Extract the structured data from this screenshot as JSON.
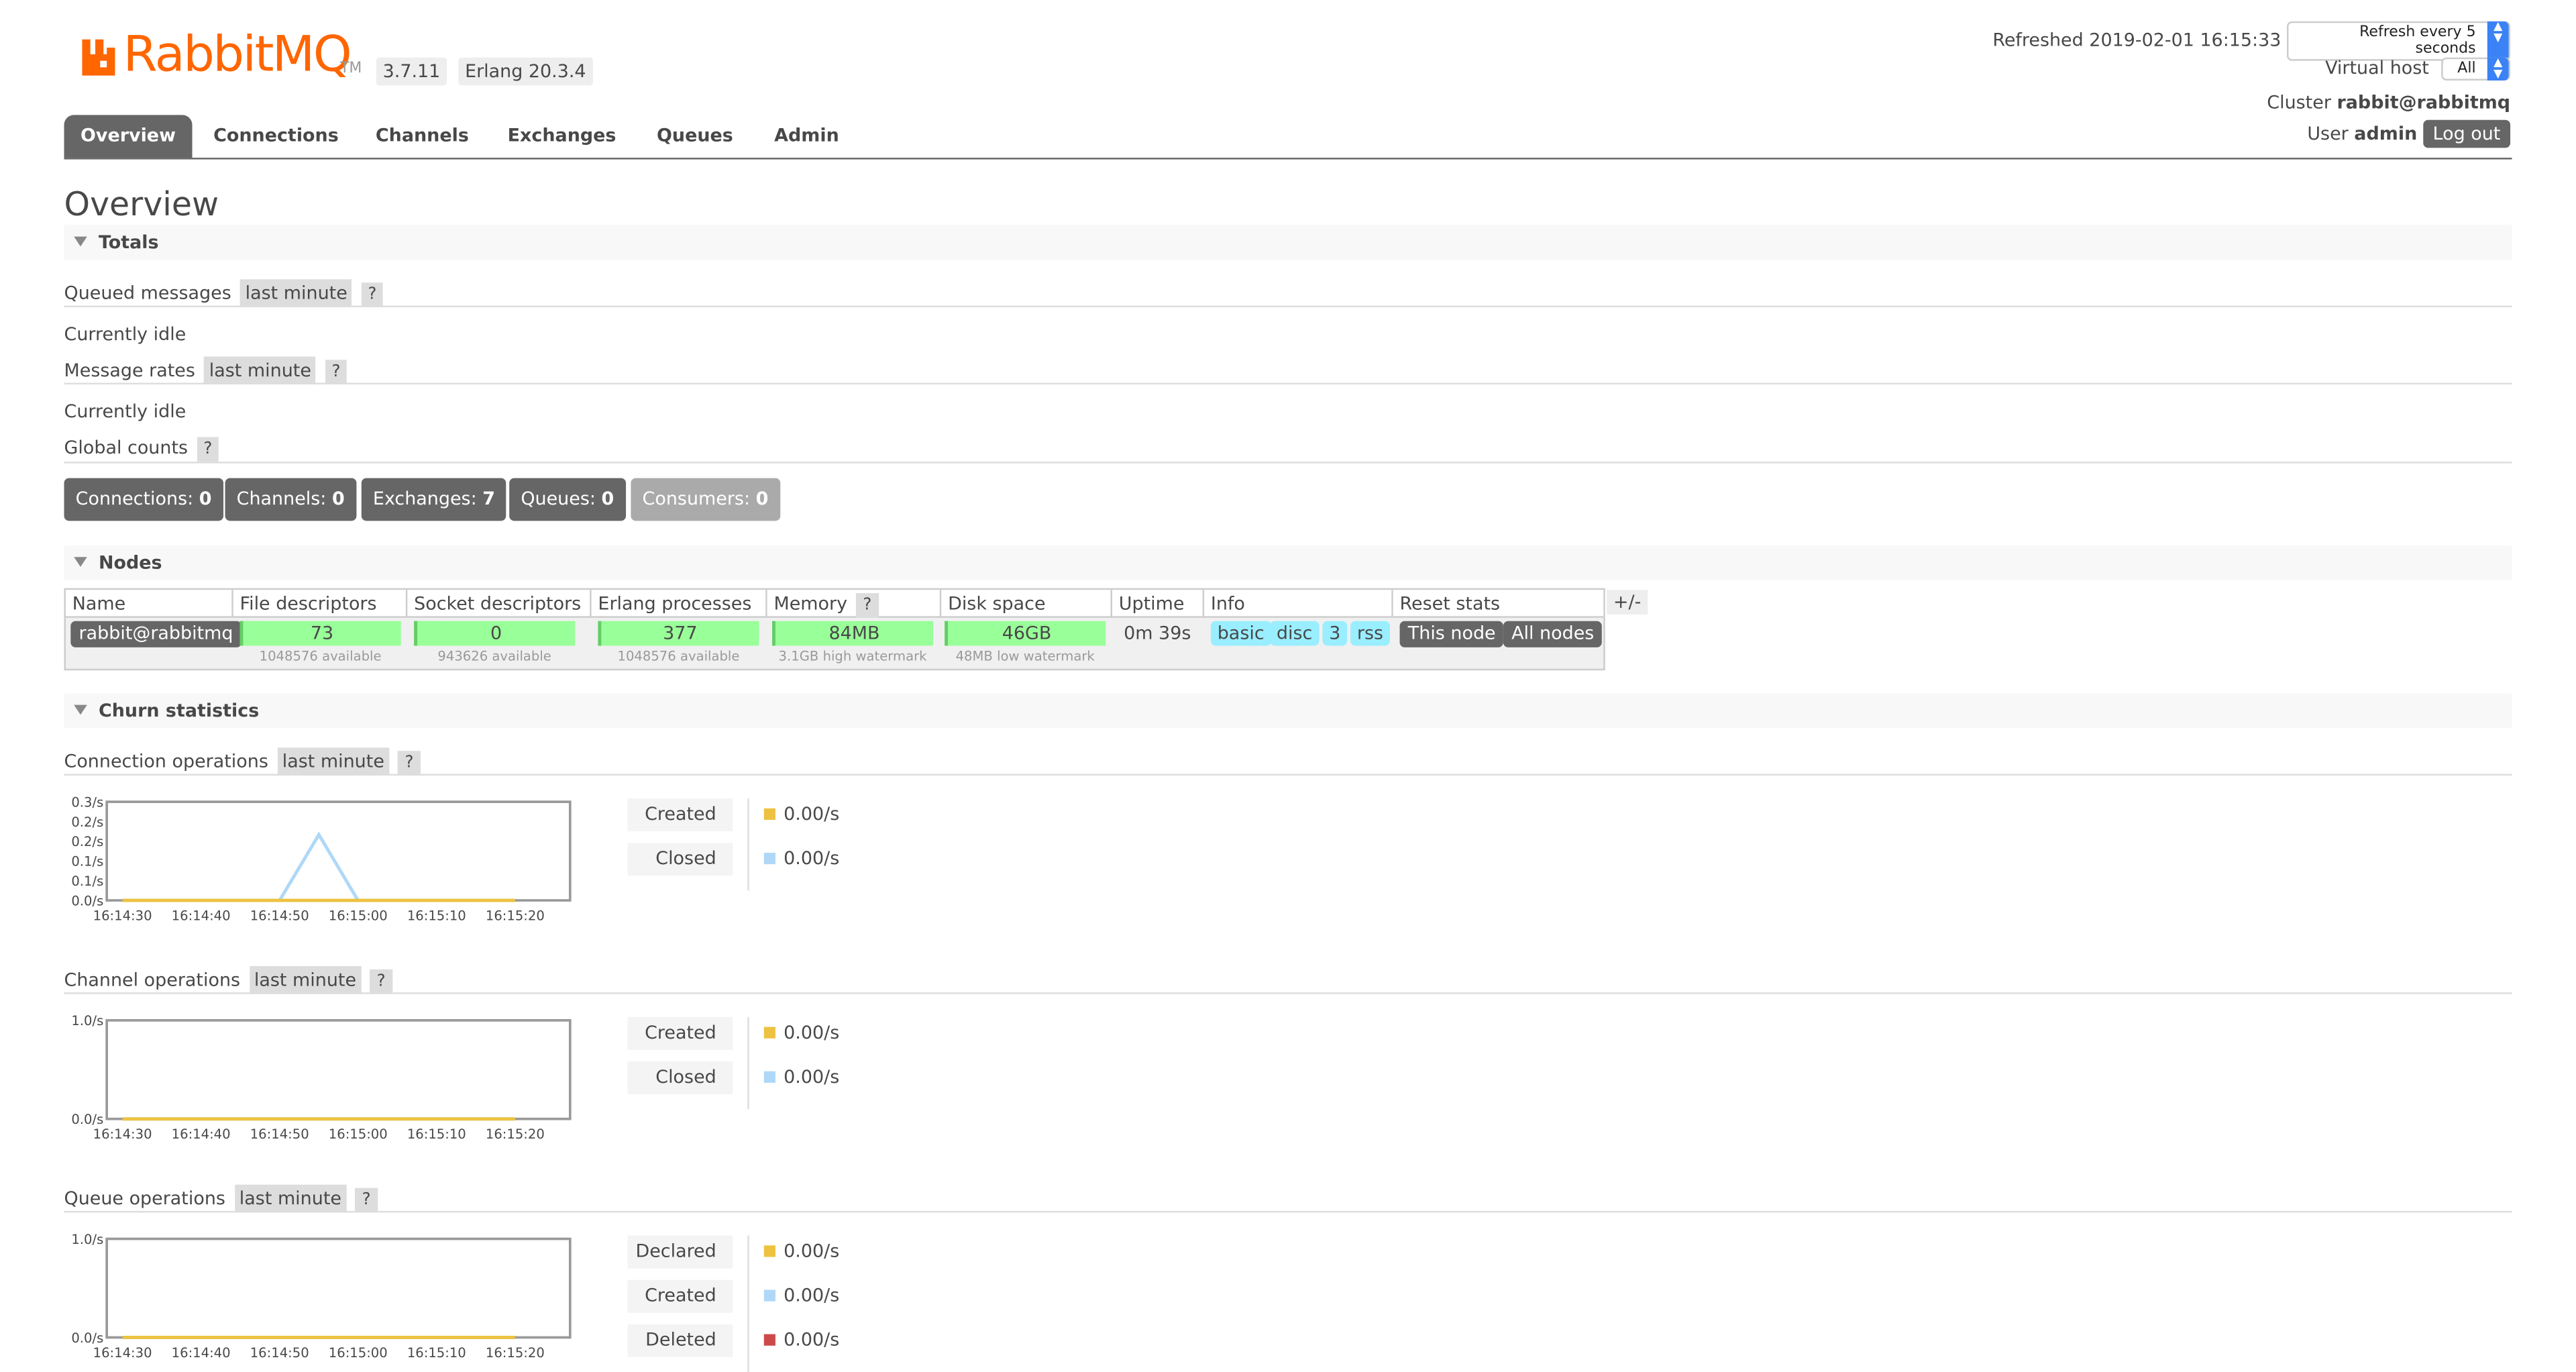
{
  "header": {
    "logo_text": "RabbitMQ",
    "logo_tm": "TM",
    "version": "3.7.11",
    "erlang": "Erlang 20.3.4",
    "refreshed": "Refreshed 2019-02-01 16:15:33",
    "refresh_select": "Refresh every 5 seconds",
    "vhost_label": "Virtual host",
    "vhost_value": "All",
    "cluster_label": "Cluster",
    "cluster_value": "rabbit@rabbitmq",
    "user_label": "User",
    "user_value": "admin",
    "logout": "Log out",
    "brand_color": "#FF6600"
  },
  "tabs": [
    "Overview",
    "Connections",
    "Channels",
    "Exchanges",
    "Queues",
    "Admin"
  ],
  "page_title": "Overview",
  "totals": {
    "section": "Totals",
    "queued_label": "Queued messages",
    "queued_period": "last minute",
    "help": "?",
    "idle1": "Currently idle",
    "rates_label": "Message rates",
    "rates_period": "last minute",
    "idle2": "Currently idle",
    "global_label": "Global counts",
    "counts": [
      {
        "label": "Connections:",
        "value": "0"
      },
      {
        "label": "Channels:",
        "value": "0"
      },
      {
        "label": "Exchanges:",
        "value": "7"
      },
      {
        "label": "Queues:",
        "value": "0"
      },
      {
        "label": "Consumers:",
        "value": "0"
      }
    ]
  },
  "nodes": {
    "section": "Nodes",
    "plusminus": "+/-",
    "headers": [
      "Name",
      "File descriptors",
      "Socket descriptors",
      "Erlang processes",
      "Memory",
      "Disk space",
      "Uptime",
      "Info",
      "Reset stats"
    ],
    "name": "rabbit@rabbitmq",
    "file_desc": "73",
    "file_desc_sub": "1048576 available",
    "socket_desc": "0",
    "socket_desc_sub": "943626 available",
    "erlang_proc": "377",
    "erlang_proc_sub": "1048576 available",
    "memory": "84MB",
    "memory_sub": "3.1GB high watermark",
    "disk": "46GB",
    "disk_sub": "48MB low watermark",
    "uptime": "0m 39s",
    "info": [
      "basic",
      "disc",
      "3",
      "rss"
    ],
    "reset": [
      "This node",
      "All nodes"
    ]
  },
  "churn": {
    "section": "Churn statistics",
    "period": "last minute",
    "help": "?",
    "charts": [
      {
        "title": "Connection operations",
        "type": "line",
        "y_ticks": [
          "0.3/s",
          "0.2/s",
          "0.2/s",
          "0.1/s",
          "0.1/s",
          "0.0/s"
        ],
        "ylim": [
          0,
          0.3
        ],
        "x_ticks": [
          "16:14:30",
          "16:14:40",
          "16:14:50",
          "16:15:00",
          "16:15:10",
          "16:15:20"
        ],
        "series": [
          {
            "name": "Created",
            "rate": "0.00/s",
            "color": "#EDC240",
            "points": [
              [
                "16:14:30",
                0
              ],
              [
                "16:14:50",
                0
              ],
              [
                "16:15:00",
                0
              ],
              [
                "16:15:20",
                0
              ]
            ]
          },
          {
            "name": "Closed",
            "rate": "0.00/s",
            "color": "#AFD8F8",
            "points": [
              [
                "16:14:30",
                0
              ],
              [
                "16:14:50",
                0
              ],
              [
                "16:14:55",
                0.2
              ],
              [
                "16:15:00",
                0
              ],
              [
                "16:15:20",
                0
              ]
            ]
          }
        ]
      },
      {
        "title": "Channel operations",
        "type": "line",
        "y_ticks": [
          "1.0/s",
          "0.0/s"
        ],
        "ylim": [
          0,
          1
        ],
        "x_ticks": [
          "16:14:30",
          "16:14:40",
          "16:14:50",
          "16:15:00",
          "16:15:10",
          "16:15:20"
        ],
        "series": [
          {
            "name": "Created",
            "rate": "0.00/s",
            "color": "#EDC240",
            "points": [
              [
                "16:14:30",
                0
              ],
              [
                "16:15:20",
                0
              ]
            ]
          },
          {
            "name": "Closed",
            "rate": "0.00/s",
            "color": "#AFD8F8",
            "points": [
              [
                "16:14:30",
                0
              ],
              [
                "16:15:20",
                0
              ]
            ]
          }
        ]
      },
      {
        "title": "Queue operations",
        "type": "line",
        "y_ticks": [
          "1.0/s",
          "0.0/s"
        ],
        "ylim": [
          0,
          1
        ],
        "x_ticks": [
          "16:14:30",
          "16:14:40",
          "16:14:50",
          "16:15:00",
          "16:15:10",
          "16:15:20"
        ],
        "series": [
          {
            "name": "Declared",
            "rate": "0.00/s",
            "color": "#EDC240",
            "points": [
              [
                "16:14:30",
                0
              ],
              [
                "16:15:20",
                0
              ]
            ]
          },
          {
            "name": "Created",
            "rate": "0.00/s",
            "color": "#AFD8F8",
            "points": [
              [
                "16:14:30",
                0
              ],
              [
                "16:15:20",
                0
              ]
            ]
          },
          {
            "name": "Deleted",
            "rate": "0.00/s",
            "color": "#CB4B4B",
            "points": [
              [
                "16:14:30",
                0
              ],
              [
                "16:15:20",
                0
              ]
            ]
          }
        ]
      }
    ]
  }
}
